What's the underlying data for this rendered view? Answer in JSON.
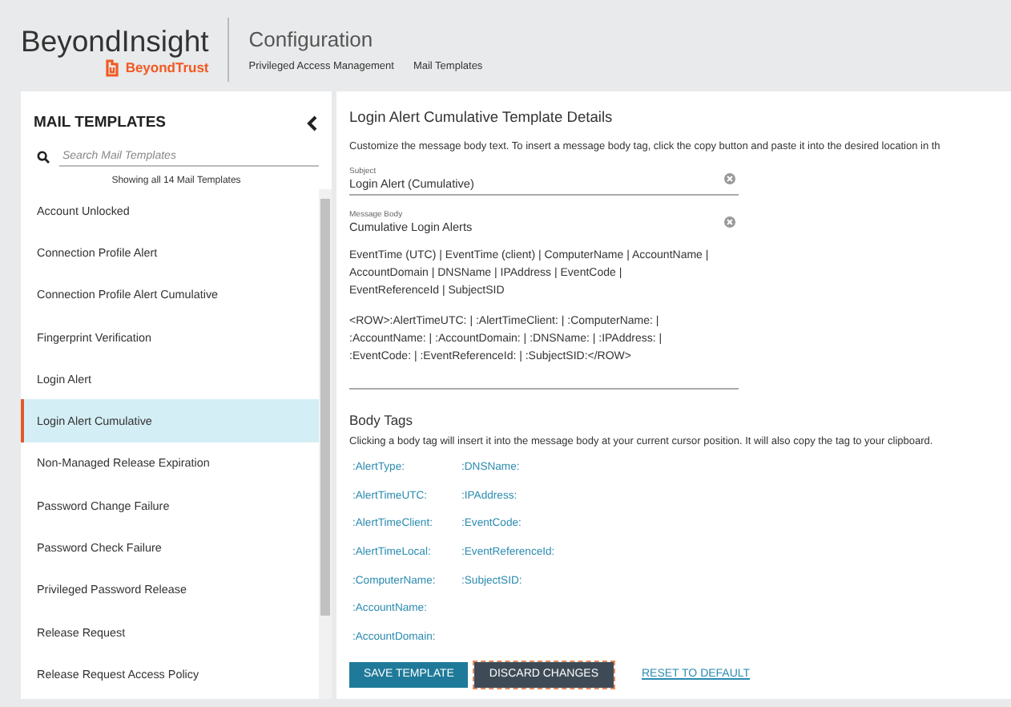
{
  "header": {
    "product": "BeyondInsight",
    "brand": "BeyondTrust",
    "section": "Configuration",
    "breadcrumbs": [
      "Privileged Access Management",
      "Mail Templates"
    ]
  },
  "sidebar": {
    "title": "MAIL TEMPLATES",
    "search": {
      "placeholder": "Search Mail Templates"
    },
    "count": "Showing all 14 Mail Templates",
    "items": [
      {
        "label": "Account Unlocked",
        "selected": false
      },
      {
        "label": "Connection Profile Alert",
        "selected": false
      },
      {
        "label": "Connection Profile Alert Cumulative",
        "selected": false
      },
      {
        "label": "Fingerprint Verification",
        "selected": false
      },
      {
        "label": "Login Alert",
        "selected": false
      },
      {
        "label": "Login Alert Cumulative",
        "selected": true
      },
      {
        "label": "Non-Managed Release Expiration",
        "selected": false
      },
      {
        "label": "Password Change Failure",
        "selected": false
      },
      {
        "label": "Password Check Failure",
        "selected": false
      },
      {
        "label": "Privileged Password Release",
        "selected": false
      },
      {
        "label": "Release Request",
        "selected": false
      },
      {
        "label": "Release Request Access Policy",
        "selected": false
      }
    ]
  },
  "details": {
    "title": "Login Alert Cumulative Template Details",
    "intro": "Customize the message body text. To insert a message body tag, click the copy button and paste it into the desired location in th",
    "subject": {
      "label": "Subject",
      "value": "Login Alert (Cumulative)"
    },
    "message_body": {
      "label": "Message Body",
      "value": "Cumulative Login Alerts",
      "paragraphs": [
        [
          "EventTime (UTC) | EventTime (client) | ComputerName | AccountName |",
          "AccountDomain | DNSName | IPAddress | EventCode |",
          "EventReferenceId | SubjectSID"
        ],
        [
          "<ROW>:AlertTimeUTC: | :AlertTimeClient: | :ComputerName: |",
          ":AccountName: | :AccountDomain: | :DNSName: | :IPAddress: |",
          ":EventCode: | :EventReferenceId: | :SubjectSID:</ROW>"
        ]
      ]
    }
  },
  "body_tags": {
    "title": "Body Tags",
    "intro": "Clicking a body tag will insert it into the message body at your current cursor position. It will also copy the tag to your clipboard.",
    "tags": [
      ":AlertType:",
      ":AlertTimeUTC:",
      ":AlertTimeClient:",
      ":AlertTimeLocal:",
      ":ComputerName:",
      ":AccountName:",
      ":AccountDomain:",
      ":DNSName:",
      ":IPAddress:",
      ":EventCode:",
      ":EventReferenceId:",
      ":SubjectSID:"
    ]
  },
  "buttons": [
    {
      "label": "SAVE TEMPLATE",
      "kind": "primary"
    },
    {
      "label": "DISCARD CHANGES",
      "kind": "secondary"
    },
    {
      "label": "RESET TO DEFAULT",
      "kind": "link"
    }
  ]
}
